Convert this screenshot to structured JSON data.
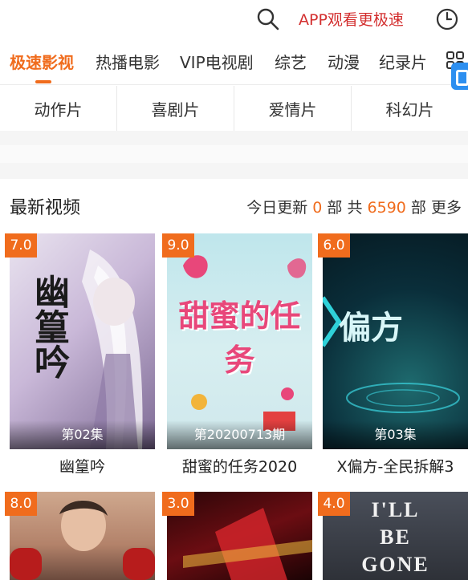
{
  "header": {
    "app_link": "APP观看更极速"
  },
  "nav": {
    "items": [
      "极速影视",
      "热播电影",
      "VIP电视剧",
      "综艺",
      "动漫",
      "纪录片"
    ]
  },
  "genres": [
    "动作片",
    "喜剧片",
    "爱情片",
    "科幻片"
  ],
  "section": {
    "title": "最新视频",
    "stats_prefix": "今日更新",
    "today_count": "0",
    "unit1": "部",
    "total_label": "共",
    "total_count": "6590",
    "unit2": "部",
    "more": "更多"
  },
  "videos": [
    {
      "rating": "7.0",
      "episode": "第02集",
      "title": "幽篁吟",
      "poster_text": "幽篁吟"
    },
    {
      "rating": "9.0",
      "episode": "第20200713期",
      "title": "甜蜜的任务2020",
      "poster_text": "甜蜜的任务"
    },
    {
      "rating": "6.0",
      "episode": "第03集",
      "title": "X偏方-全民拆解3",
      "poster_text": "偏方"
    },
    {
      "rating": "8.0",
      "episode": "",
      "title": "",
      "poster_text": ""
    },
    {
      "rating": "3.0",
      "episode": "",
      "title": "",
      "poster_text": ""
    },
    {
      "rating": "4.0",
      "episode": "",
      "title": "",
      "poster_text": "I'LL BE GONE"
    }
  ],
  "colors": {
    "accent": "#f06c1d",
    "app_link": "#d32f2f"
  }
}
